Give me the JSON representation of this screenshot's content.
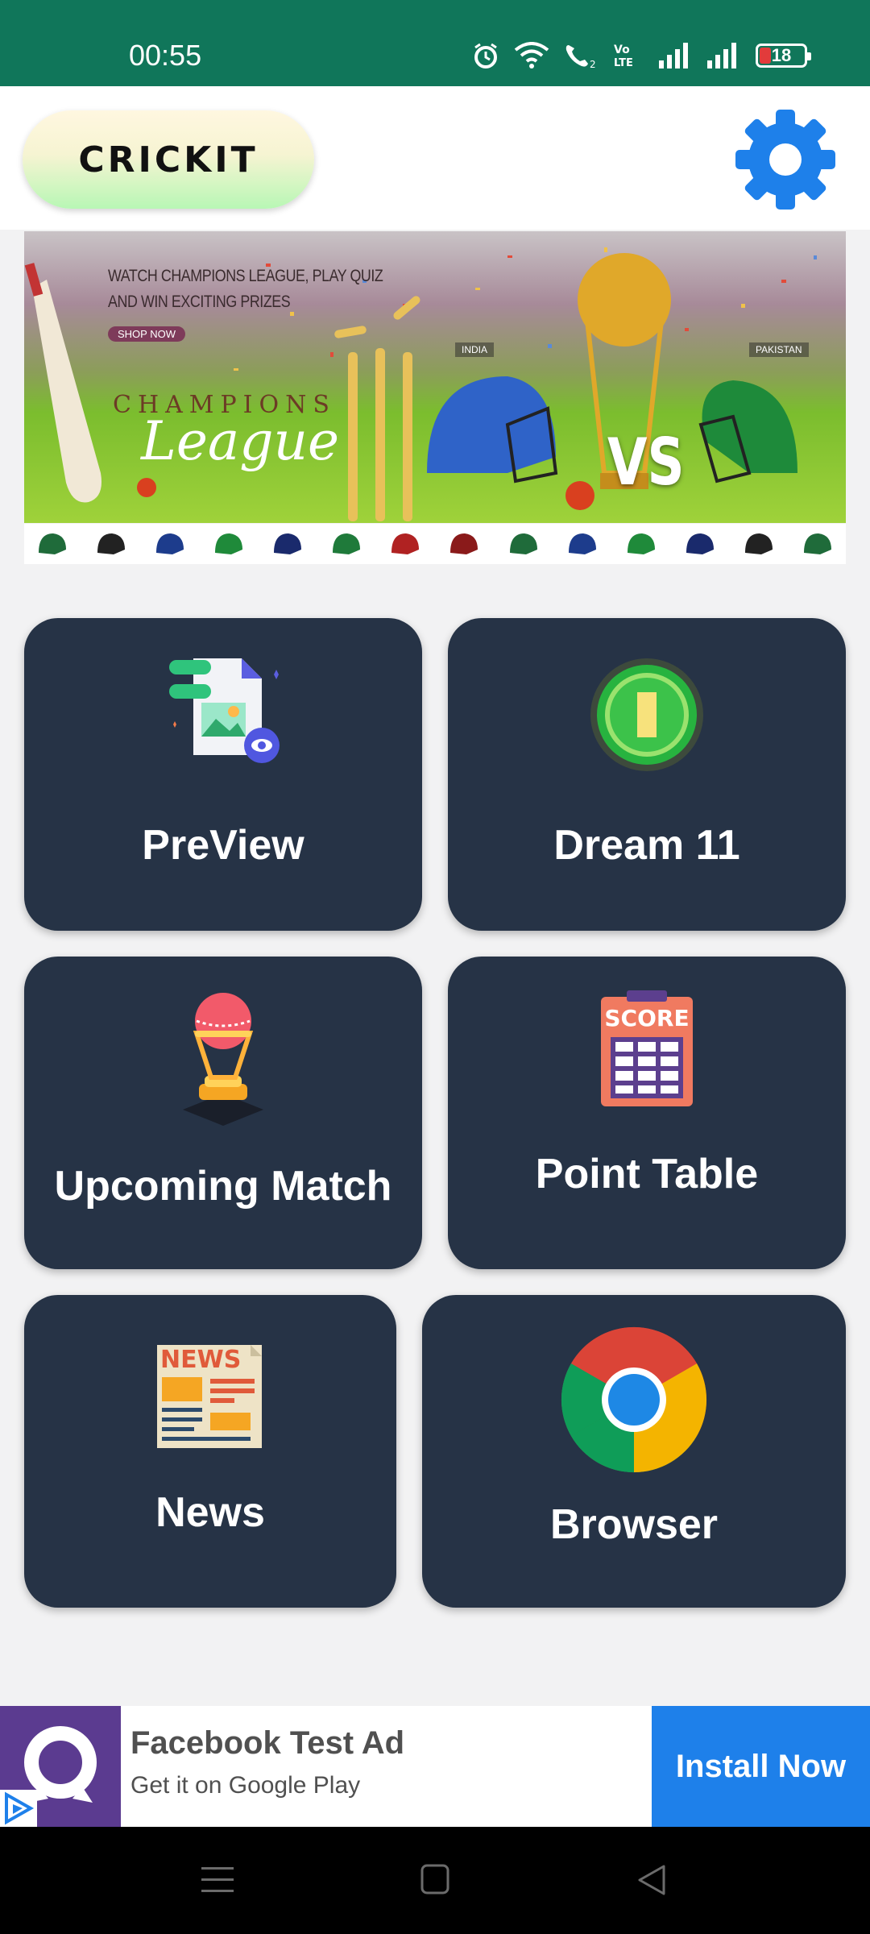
{
  "status_bar": {
    "time": "00:55",
    "battery_level": "18",
    "battery_color": "#e23b3b",
    "background": "#10765a",
    "icons": [
      "alarm-icon",
      "wifi-icon",
      "wifi-calling-icon",
      "volte-icon",
      "signal-icon",
      "signal-icon",
      "battery-icon"
    ]
  },
  "header": {
    "logo_text": "CRICKIT",
    "settings_icon": "gear-icon",
    "settings_color": "#1e80ea"
  },
  "banner": {
    "line1": "WATCH CHAMPIONS LEAGUE, PLAY QUIZ",
    "line2": "AND WIN EXCITING PRIZES",
    "shop_now": "SHOP NOW",
    "champions": "CHAMPIONS",
    "league": "League",
    "team_left": "INDIA",
    "team_right": "PAKISTAN",
    "vs": "VS"
  },
  "menu": {
    "card_color": "#263346",
    "items": [
      {
        "label": "PreView",
        "icon": "document-preview-icon"
      },
      {
        "label": "Dream 11",
        "icon": "cricket-pitch-icon"
      },
      {
        "label": "Upcoming Match",
        "icon": "trophy-icon"
      },
      {
        "label": "Point Table",
        "icon": "scoreboard-icon"
      },
      {
        "label": "News",
        "icon": "newspaper-icon"
      },
      {
        "label": "Browser",
        "icon": "chrome-icon"
      }
    ],
    "score_word": "SCORE",
    "news_word": "NEWS"
  },
  "ad": {
    "title": "Facebook Test Ad",
    "subtitle": "Get it on Google Play",
    "button": "Install Now",
    "button_color": "#1e80ea"
  },
  "nav": {
    "buttons": [
      "menu-icon",
      "home-icon",
      "back-icon"
    ]
  }
}
